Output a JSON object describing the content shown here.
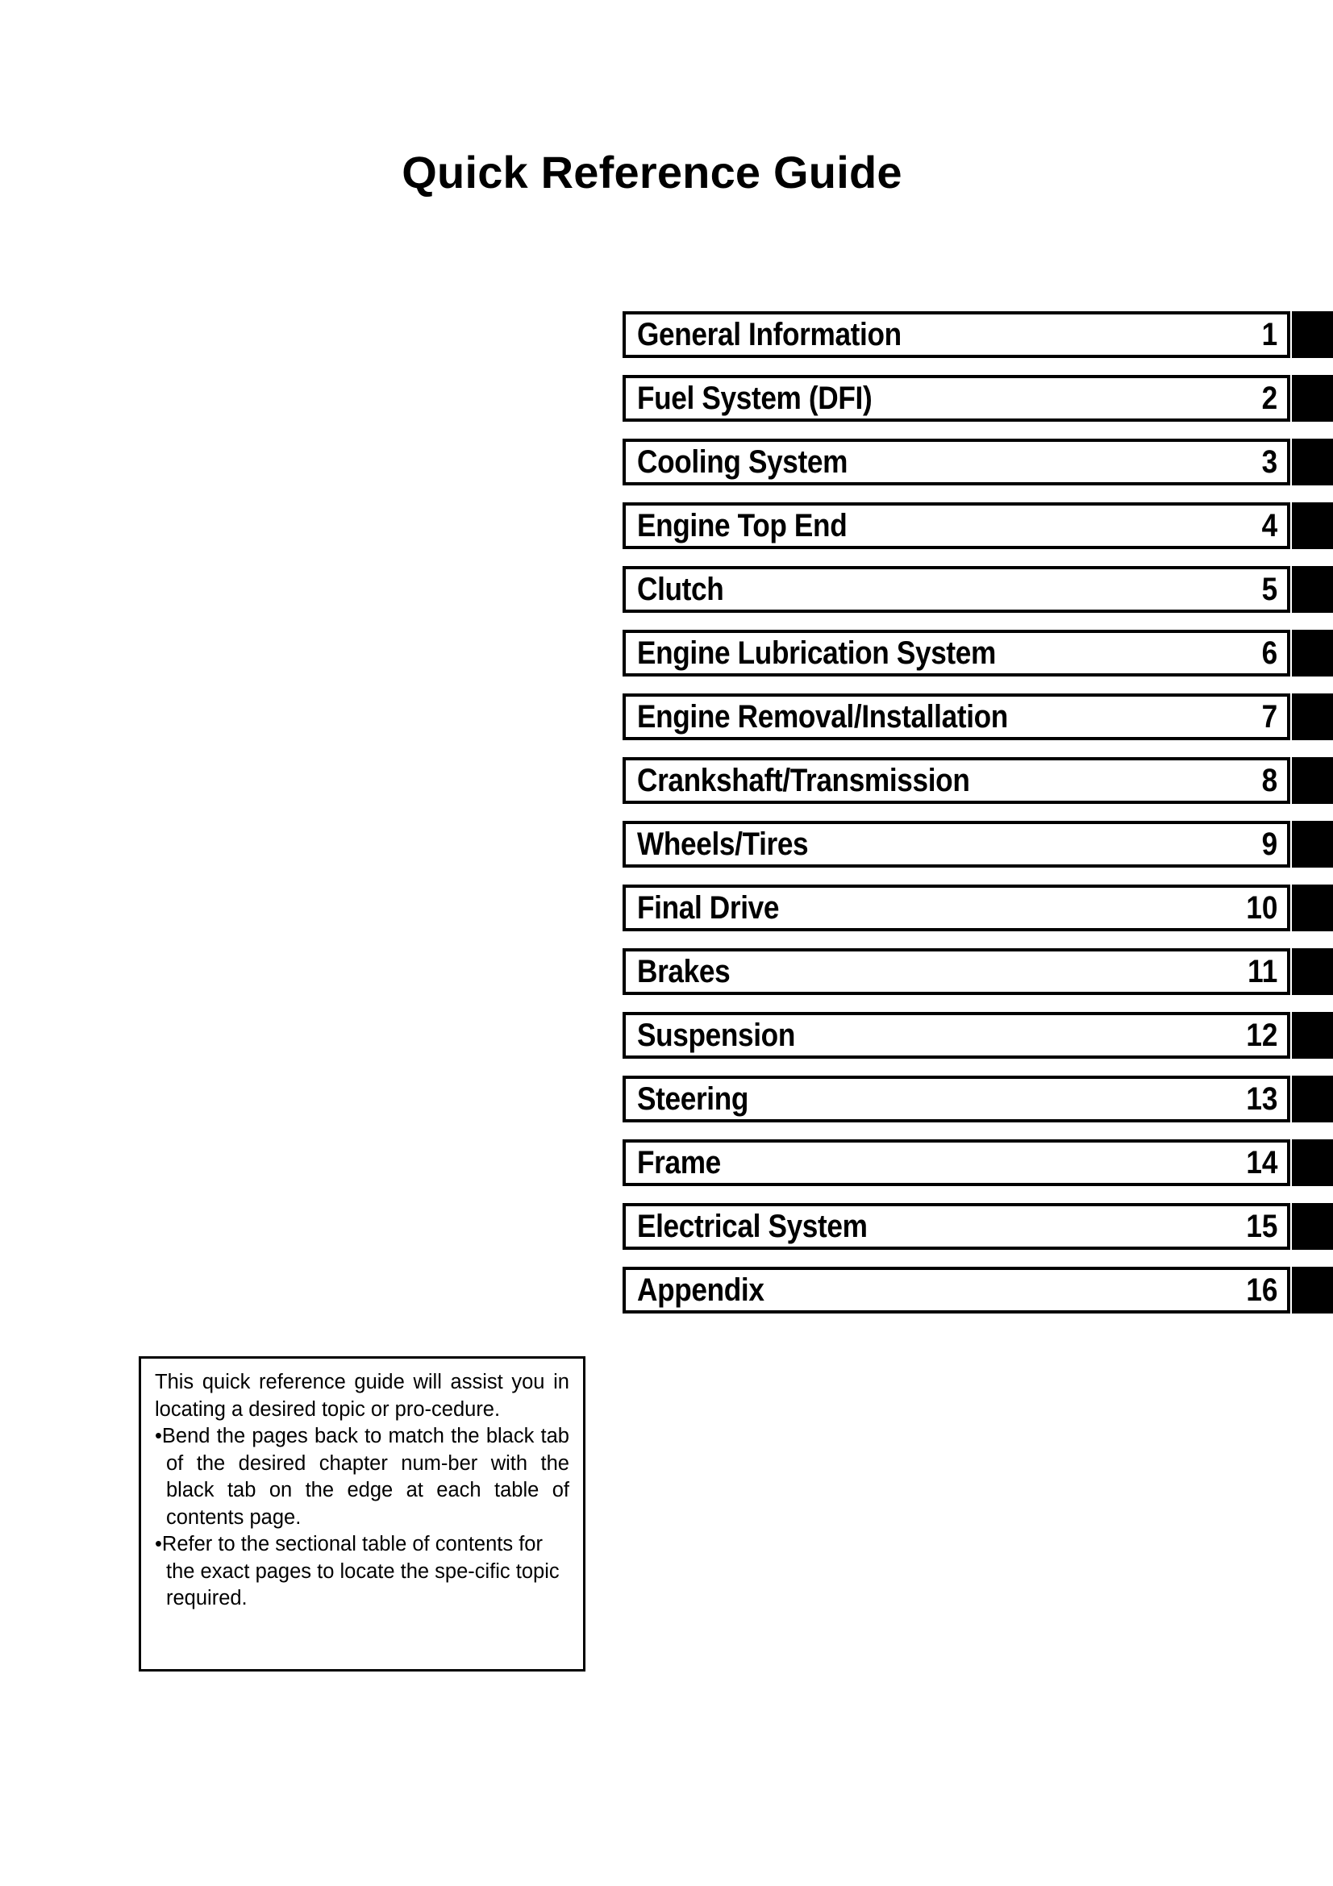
{
  "document": {
    "title": "Quick Reference Guide"
  },
  "chapter_index": {
    "rows": [
      {
        "title": "General Information",
        "number": "1"
      },
      {
        "title": "Fuel System (DFI)",
        "number": "2"
      },
      {
        "title": "Cooling System",
        "number": "3"
      },
      {
        "title": "Engine Top End",
        "number": "4"
      },
      {
        "title": "Clutch",
        "number": "5"
      },
      {
        "title": "Engine Lubrication System",
        "number": "6"
      },
      {
        "title": "Engine Removal/Installation",
        "number": "7"
      },
      {
        "title": "Crankshaft/Transmission",
        "number": "8"
      },
      {
        "title": "Wheels/Tires",
        "number": "9"
      },
      {
        "title": "Final Drive",
        "number": "10"
      },
      {
        "title": "Brakes",
        "number": "11"
      },
      {
        "title": "Suspension",
        "number": "12"
      },
      {
        "title": "Steering",
        "number": "13"
      },
      {
        "title": "Frame",
        "number": "14"
      },
      {
        "title": "Electrical System",
        "number": "15"
      },
      {
        "title": "Appendix",
        "number": "16"
      }
    ]
  },
  "note_box": {
    "intro": "This quick reference guide will assist you in locating a desired topic or pro-cedure.",
    "bullet_1": "•Bend the pages back to match the black tab of the desired chapter num-ber with the black tab on the edge at each table of contents page.",
    "bullet_2": "•Refer to the sectional table of contents for the exact pages to locate the spe-cific topic required."
  },
  "colors": {
    "ink": "#000000",
    "paper": "#ffffff"
  }
}
